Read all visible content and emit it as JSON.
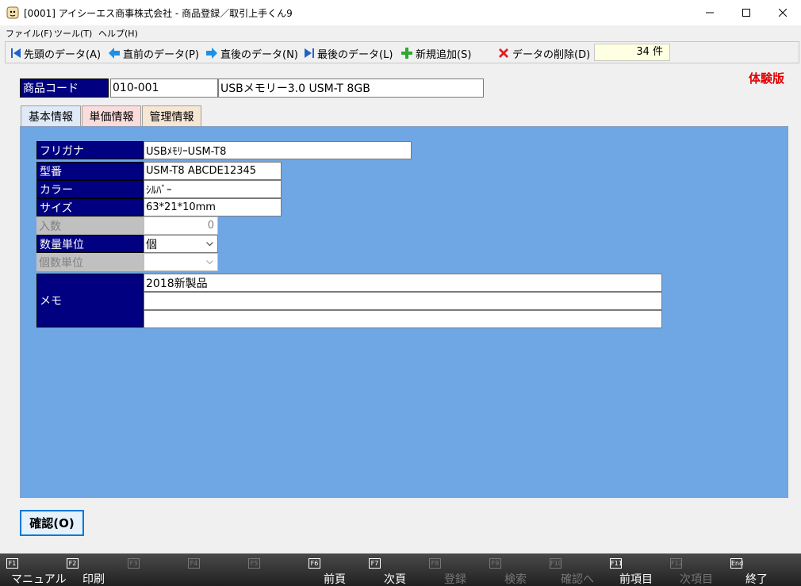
{
  "window": {
    "title": "[0001] アイシーエス商事株式会社 - 商品登録／取引上手くん9"
  },
  "menu": [
    {
      "label": "ファイル(F)"
    },
    {
      "label": "ツール(T)"
    },
    {
      "label": "ヘルプ(H)"
    }
  ],
  "toolbar": {
    "first_label": "先頭のデータ(A)",
    "prev_label": "直前のデータ(P)",
    "next_label": "直後のデータ(N)",
    "last_label": "最後のデータ(L)",
    "add_label": "新規追加(S)",
    "delete_label": "データの削除(D)",
    "record_count": "34 件"
  },
  "trial_label": "体験版",
  "product": {
    "code_label": "商品コード",
    "code": "010-001",
    "name": "USBメモリー3.0 USM-T 8GB"
  },
  "tabs": [
    {
      "label": "基本情報",
      "active": true
    },
    {
      "label": "単価情報",
      "active": false
    },
    {
      "label": "管理情報",
      "active": false
    }
  ],
  "form": {
    "furigana_label": "フリガナ",
    "furigana": "USBﾒﾓﾘｰUSM-T8",
    "model_label": "型番",
    "model": "USM-T8 ABCDE12345",
    "color_label": "カラー",
    "color": "ｼﾙﾊﾞｰ",
    "size_label": "サイズ",
    "size": "63*21*10mm",
    "qty_label": "入数",
    "qty": "0",
    "unit_label": "数量単位",
    "unit": "個",
    "pieces_unit_label": "個数単位",
    "pieces_unit": "",
    "memo_label": "メモ",
    "memo_lines": [
      "2018新製品",
      "",
      ""
    ]
  },
  "confirm_label": "確認(O)",
  "fkeys": [
    {
      "key": "F1",
      "label": "マニュアル",
      "enabled": true
    },
    {
      "key": "F2",
      "label": "印刷",
      "enabled": true
    },
    {
      "key": "F3",
      "label": "",
      "enabled": false
    },
    {
      "key": "F4",
      "label": "",
      "enabled": false
    },
    {
      "key": "F5",
      "label": "",
      "enabled": false
    },
    {
      "key": "F6",
      "label": "前頁",
      "enabled": true
    },
    {
      "key": "F7",
      "label": "次頁",
      "enabled": true
    },
    {
      "key": "F8",
      "label": "登録",
      "enabled": false
    },
    {
      "key": "F9",
      "label": "検索",
      "enabled": false
    },
    {
      "key": "F10",
      "label": "確認へ",
      "enabled": false
    },
    {
      "key": "F11",
      "label": "前項目",
      "enabled": true
    },
    {
      "key": "F12",
      "label": "次項目",
      "enabled": false
    },
    {
      "key": "End",
      "label": "終了",
      "enabled": true
    }
  ],
  "colors": {
    "label_navy": "#000080",
    "panel_blue": "#6fa6e4",
    "trial_red": "#e00000",
    "count_bg": "#ffffe1"
  }
}
